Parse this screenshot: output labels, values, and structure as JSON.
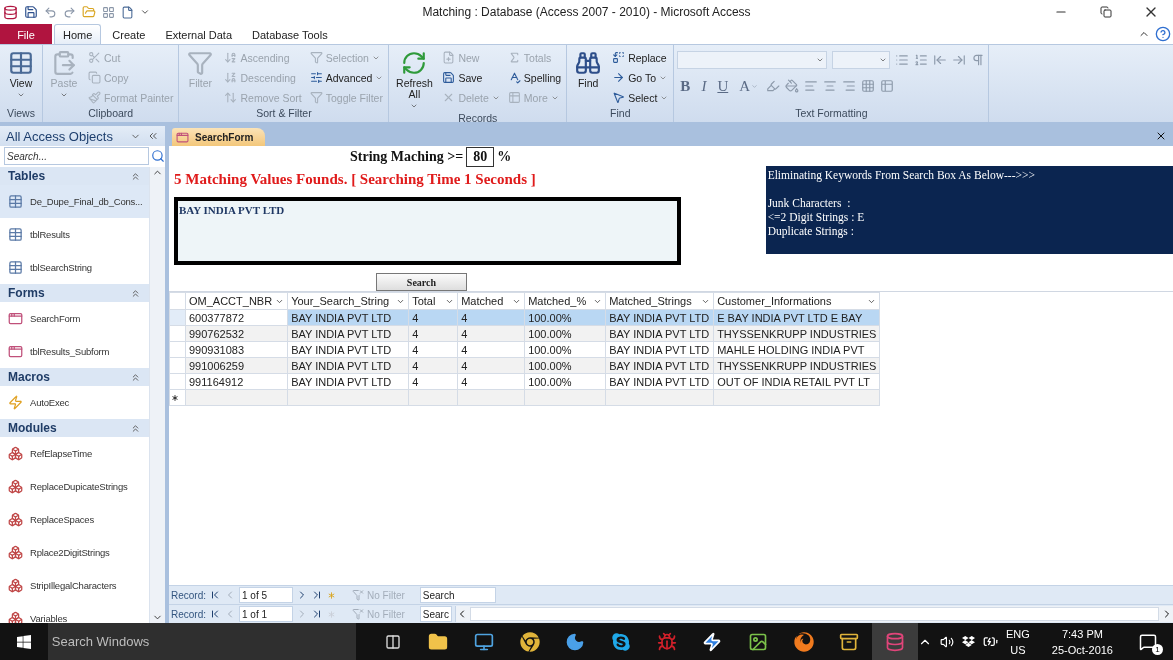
{
  "window": {
    "title": "Matching : Database (Access 2007 - 2010) - Microsoft Access"
  },
  "ribbon_tabs": [
    {
      "label": "File",
      "kind": "file",
      "selected": false
    },
    {
      "label": "Home",
      "kind": "tab",
      "selected": true
    },
    {
      "label": "Create",
      "kind": "tab",
      "selected": false
    },
    {
      "label": "External Data",
      "kind": "tab",
      "selected": false
    },
    {
      "label": "Database Tools",
      "kind": "tab",
      "selected": false
    }
  ],
  "ribbon_groups": [
    {
      "label": "Views",
      "kind": "commands",
      "columns": [
        [
          {
            "label": "View",
            "kind": "large",
            "dropdown": true,
            "disabled": false
          }
        ]
      ]
    },
    {
      "label": "Clipboard",
      "kind": "commands",
      "columns": [
        [
          {
            "label": "Paste",
            "kind": "large",
            "dropdown": true,
            "disabled": true
          }
        ],
        [
          {
            "label": "Cut",
            "kind": "small",
            "dropdown": false,
            "disabled": true
          },
          {
            "label": "Copy",
            "kind": "small",
            "dropdown": false,
            "disabled": true
          },
          {
            "label": "Format Painter",
            "kind": "small",
            "dropdown": false,
            "disabled": true
          }
        ]
      ]
    },
    {
      "label": "Sort & Filter",
      "kind": "commands",
      "columns": [
        [
          {
            "label": "Filter",
            "kind": "large",
            "dropdown": false,
            "disabled": true
          }
        ],
        [
          {
            "label": "Ascending",
            "kind": "small",
            "dropdown": false,
            "disabled": true
          },
          {
            "label": "Descending",
            "kind": "small",
            "dropdown": false,
            "disabled": true
          },
          {
            "label": "Remove Sort",
            "kind": "small",
            "dropdown": false,
            "disabled": true
          }
        ],
        [
          {
            "label": "Selection",
            "kind": "small",
            "dropdown": true,
            "disabled": true
          },
          {
            "label": "Advanced",
            "kind": "small",
            "dropdown": true,
            "disabled": false
          },
          {
            "label": "Toggle Filter",
            "kind": "small",
            "dropdown": false,
            "disabled": true
          }
        ]
      ]
    },
    {
      "label": "Records",
      "kind": "commands",
      "columns": [
        [
          {
            "label": "Refresh All",
            "kind": "large",
            "dropdown": true,
            "disabled": false
          }
        ],
        [
          {
            "label": "New",
            "kind": "small",
            "dropdown": false,
            "disabled": true
          },
          {
            "label": "Save",
            "kind": "small",
            "dropdown": false,
            "disabled": false
          },
          {
            "label": "Delete",
            "kind": "small",
            "dropdown": true,
            "disabled": true
          }
        ],
        [
          {
            "label": "Totals",
            "kind": "small",
            "dropdown": false,
            "disabled": true
          },
          {
            "label": "Spelling",
            "kind": "small",
            "dropdown": false,
            "disabled": false
          },
          {
            "label": "More",
            "kind": "small",
            "dropdown": true,
            "disabled": true
          }
        ]
      ]
    },
    {
      "label": "Find",
      "kind": "commands",
      "columns": [
        [
          {
            "label": "Find",
            "kind": "large",
            "dropdown": false,
            "disabled": false
          }
        ],
        [
          {
            "label": "Replace",
            "kind": "small",
            "dropdown": false,
            "disabled": false
          },
          {
            "label": "Go To",
            "kind": "small",
            "dropdown": true,
            "disabled": false
          },
          {
            "label": "Select",
            "kind": "small",
            "dropdown": true,
            "disabled": false
          }
        ]
      ]
    },
    {
      "label": "Text Formatting",
      "kind": "formatting",
      "letters": [
        "B",
        "I",
        "U",
        "A"
      ]
    }
  ],
  "navigation_pane": {
    "title": "All Access Objects",
    "search_placeholder": "Search...",
    "sections": [
      {
        "label": "Tables",
        "kind": "table",
        "expanded": true,
        "items": [
          {
            "label": "De_Dupe_Final_db_Cons...",
            "selected": true
          },
          {
            "label": "tblResults",
            "selected": false
          },
          {
            "label": "tblSearchString",
            "selected": false
          }
        ]
      },
      {
        "label": "Forms",
        "kind": "form",
        "expanded": true,
        "items": [
          {
            "label": "SearchForm",
            "selected": false
          },
          {
            "label": "tblResults_Subform",
            "selected": false
          }
        ]
      },
      {
        "label": "Macros",
        "kind": "macro",
        "expanded": true,
        "items": [
          {
            "label": "AutoExec",
            "selected": false
          }
        ]
      },
      {
        "label": "Modules",
        "kind": "module",
        "expanded": true,
        "items": [
          {
            "label": "RefElapseTime",
            "selected": false
          },
          {
            "label": "ReplaceDupicateStrings",
            "selected": false
          },
          {
            "label": "ReplaceSpaces",
            "selected": false
          },
          {
            "label": "Rplace2DigitStrings",
            "selected": false
          },
          {
            "label": "StripIllegalCharacters",
            "selected": false
          },
          {
            "label": "Variables",
            "selected": false
          }
        ]
      }
    ]
  },
  "document_tabs": [
    {
      "label": "SearchForm",
      "selected": true
    }
  ],
  "form": {
    "threshold_label": "String Maching >=",
    "threshold_value": "80",
    "threshold_unit": "%",
    "result_message": "5 Matching Values Founds. [ Searching Time 1 Seconds ]",
    "search_text": "BAY INDIA PVT LTD",
    "search_button": "Search",
    "info_box": {
      "title": "Eliminating Keywords From Search Box As Below--->>>",
      "lines": [
        "Junk Characters  :",
        "<=2 Digit Strings : E",
        "Duplicate Strings :"
      ]
    }
  },
  "table": {
    "columns": [
      "OM_ACCT_NBR",
      "Your_Search_String",
      "Total",
      "Matched",
      "Matched_%",
      "Matched_Strings",
      "Customer_Informations"
    ],
    "rows": [
      {
        "selected": true,
        "cells": [
          "600377872",
          "BAY INDIA PVT LTD",
          "4",
          "4",
          "100.00%",
          "BAY INDIA PVT LTD",
          "E BAY INDIA PVT LTD E BAY"
        ]
      },
      {
        "selected": false,
        "cells": [
          "990762532",
          "BAY INDIA PVT LTD",
          "4",
          "4",
          "100.00%",
          "BAY INDIA PVT LTD",
          "THYSSENKRUPP INDUSTRIES"
        ]
      },
      {
        "selected": false,
        "cells": [
          "990931083",
          "BAY INDIA PVT LTD",
          "4",
          "4",
          "100.00%",
          "BAY INDIA PVT LTD",
          "MAHLE HOLDING INDIA PVT"
        ]
      },
      {
        "selected": false,
        "cells": [
          "991006259",
          "BAY INDIA PVT LTD",
          "4",
          "4",
          "100.00%",
          "BAY INDIA PVT LTD",
          "THYSSENKRUPP INDUSTRIES"
        ]
      },
      {
        "selected": false,
        "cells": [
          "991164912",
          "BAY INDIA PVT LTD",
          "4",
          "4",
          "100.00%",
          "BAY INDIA PVT LTD",
          "OUT OF INDIA RETAIL PVT LT"
        ]
      }
    ]
  },
  "record_navigators": [
    {
      "kind": "datasheet",
      "label": "Record:",
      "position": "1 of 5",
      "filter": "No Filter",
      "search": "Search"
    },
    {
      "kind": "form",
      "label": "Record:",
      "position": "1 of 1",
      "filter": "No Filter",
      "search": "Searc"
    }
  ],
  "taskbar": {
    "search_placeholder": "Search Windows",
    "language": "ENG",
    "region": "US",
    "time": "7:43 PM",
    "date": "25-Oct-2016",
    "notification_count": "1"
  }
}
